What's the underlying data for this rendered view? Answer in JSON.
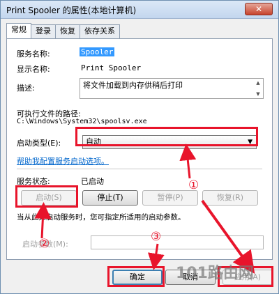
{
  "window": {
    "title": "Print Spooler 的属性(本地计算机)",
    "close_symbol": "✕"
  },
  "tabs": [
    {
      "label": "常规"
    },
    {
      "label": "登录"
    },
    {
      "label": "恢复"
    },
    {
      "label": "依存关系"
    }
  ],
  "general": {
    "service_name_label": "服务名称:",
    "service_name_value": "Spooler",
    "display_name_label": "显示名称:",
    "display_name_value": "Print Spooler",
    "description_label": "描述:",
    "description_value": "将文件加载到内存供稍后打印",
    "exe_path_label": "可执行文件的路径:",
    "exe_path_value": "C:\\Windows\\System32\\spoolsv.exe",
    "startup_type_label": "启动类型(E):",
    "startup_type_value": "自动",
    "help_link": "帮助我配置服务启动选项。",
    "status_label": "服务状态:",
    "status_value": "已启动",
    "start_button": "启动(S)",
    "stop_button": "停止(T)",
    "pause_button": "暂停(P)",
    "resume_button": "恢复(R)",
    "hint_text": "当从此处启动服务时，您可指定所适用的启动参数。",
    "params_label": "启动参数(M):"
  },
  "footer": {
    "ok_button": "确定",
    "cancel_button": "取消",
    "apply_button": "应用(A)"
  },
  "annotations": {
    "marker_1": "①",
    "marker_2": "②",
    "marker_3": "③",
    "accent_color": "#e8142b"
  },
  "watermark": "101路由网"
}
